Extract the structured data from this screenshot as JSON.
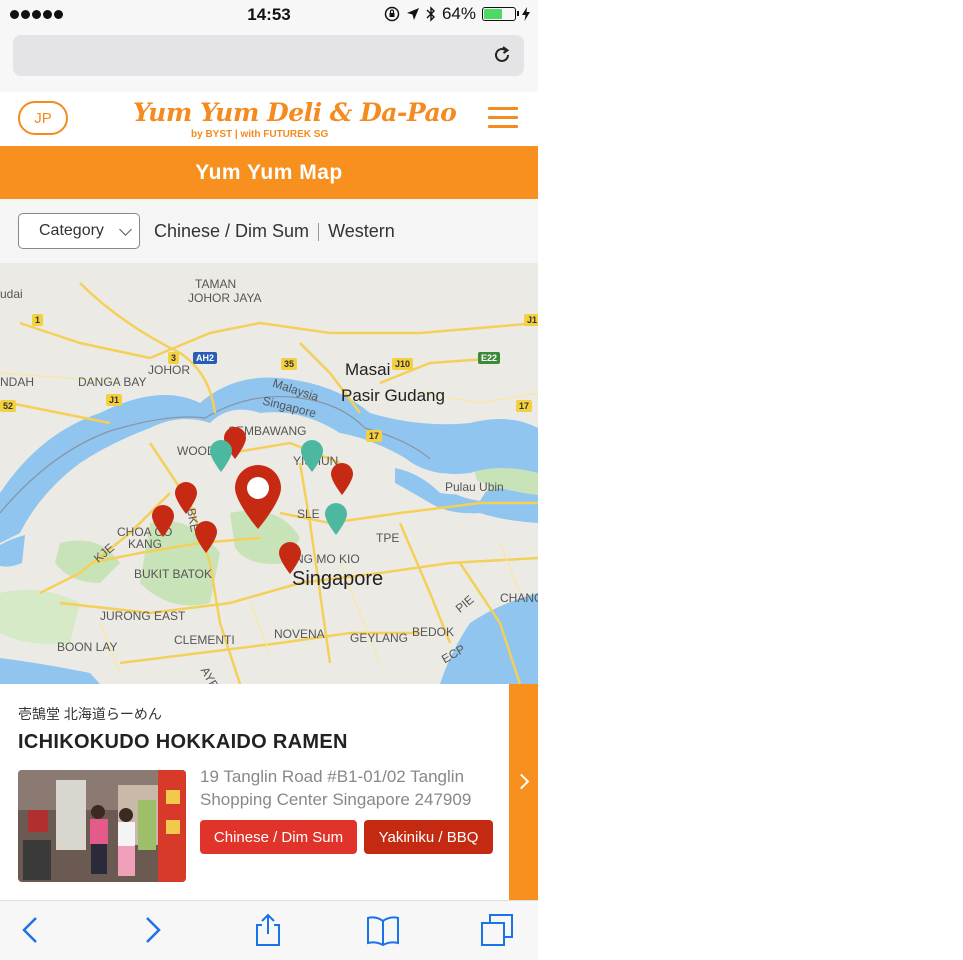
{
  "status_bar": {
    "time": "14:53",
    "battery_percent": "64%",
    "battery_level": 0.64
  },
  "header": {
    "language_button": "JP",
    "logo_text": "Yum Yum Deli & Da-Pao",
    "logo_subtitle": "by BYST | with FUTUREK SG"
  },
  "page_title": "Yum Yum Map",
  "filter": {
    "category_label": "Category",
    "options": [
      "Chinese / Dim Sum",
      "Western"
    ]
  },
  "map": {
    "labels": [
      {
        "text": "udai",
        "cls": ""
      },
      {
        "text": "TAMAN",
        "cls": ""
      },
      {
        "text": "JOHOR JAYA",
        "cls": ""
      },
      {
        "text": "JOHOR",
        "cls": ""
      },
      {
        "text": "NDAH",
        "cls": ""
      },
      {
        "text": "DANGA BAY",
        "cls": ""
      },
      {
        "text": "Masai",
        "cls": "big"
      },
      {
        "text": "Pasir Gudang",
        "cls": "big"
      },
      {
        "text": "Malaysia",
        "cls": ""
      },
      {
        "text": "Singapore",
        "cls": ""
      },
      {
        "text": "SEMBAWANG",
        "cls": ""
      },
      {
        "text": "WOOD",
        "cls": ""
      },
      {
        "text": "YISHUN",
        "cls": ""
      },
      {
        "text": "Pulau Ubin",
        "cls": ""
      },
      {
        "text": "CHOA CO",
        "cls": ""
      },
      {
        "text": "KANG",
        "cls": ""
      },
      {
        "text": "SLE",
        "cls": ""
      },
      {
        "text": "TPE",
        "cls": ""
      },
      {
        "text": "BKE",
        "cls": ""
      },
      {
        "text": "KJE",
        "cls": ""
      },
      {
        "text": "ANG MO KIO",
        "cls": ""
      },
      {
        "text": "Singapore",
        "cls": "city"
      },
      {
        "text": "BUKIT BATOK",
        "cls": ""
      },
      {
        "text": "PIE",
        "cls": ""
      },
      {
        "text": "CHANG",
        "cls": ""
      },
      {
        "text": "JURONG EAST",
        "cls": ""
      },
      {
        "text": "CLEMENTI",
        "cls": ""
      },
      {
        "text": "BOON LAY",
        "cls": ""
      },
      {
        "text": "NOVENA",
        "cls": ""
      },
      {
        "text": "GEYLANG",
        "cls": ""
      },
      {
        "text": "BEDOK",
        "cls": ""
      },
      {
        "text": "ECP",
        "cls": ""
      },
      {
        "text": "AYE",
        "cls": ""
      }
    ],
    "road_badges": [
      {
        "text": "1",
        "cls": "rb-yellow"
      },
      {
        "text": "3",
        "cls": "rb-yellow"
      },
      {
        "text": "AH2",
        "cls": "rb-blue"
      },
      {
        "text": "35",
        "cls": "rb-yellow"
      },
      {
        "text": "J10",
        "cls": "rb-yellow"
      },
      {
        "text": "E22",
        "cls": "rb-green"
      },
      {
        "text": "J1",
        "cls": "rb-yellow"
      },
      {
        "text": "52",
        "cls": "rb-yellow"
      },
      {
        "text": "17",
        "cls": "rb-yellow"
      },
      {
        "text": "17",
        "cls": "rb-yellow"
      },
      {
        "text": "J1",
        "cls": "rb-yellow"
      }
    ],
    "markers_colors": {
      "red": "#c62a12",
      "teal": "#4cb8a0",
      "selected": "#c62a12"
    }
  },
  "card": {
    "japanese_name": "壱鵠堂 北海道らーめん",
    "title": "ICHIKOKUDO HOKKAIDO RAMEN",
    "address": "19 Tanglin Road #B1-01/02 Tanglin Shopping Center Singapore 247909",
    "tags": [
      "Chinese / Dim Sum",
      "Yakiniku / BBQ"
    ]
  },
  "colors": {
    "brand_orange": "#f7901e",
    "tag_red": "#e0332a",
    "tag_dark_red": "#c42a12",
    "ios_blue": "#1a73e8"
  }
}
